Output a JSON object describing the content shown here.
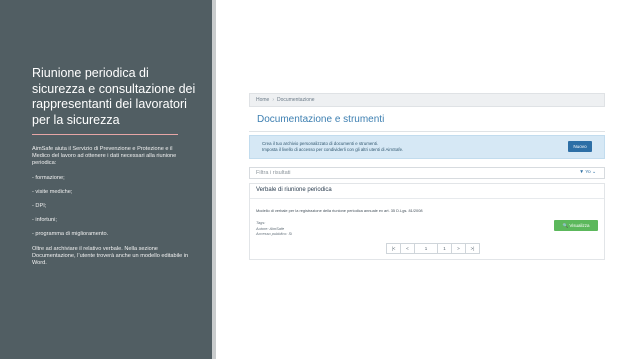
{
  "slide": {
    "title": "Riunione periodica di sicurezza e consultazione dei rappresentanti dei lavoratori per la sicurezza",
    "intro": "AimSafe aiuta il Servizio di Prevenzione e Protezione e il Medico del lavoro ad ottenere i dati necessari alla riunione periodica:",
    "items": [
      "- formazione;",
      "- visite mediche;",
      "- DPI;",
      "- infortuni;",
      "- programma di miglioramento."
    ],
    "outro": "Oltre ad archiviare il relativo verbale. Nella sezione Documentazione, l’utente troverà anche un modello editabile in Word."
  },
  "app": {
    "breadcrumb": {
      "home": "Home",
      "sep": "›",
      "current": "Documentazione"
    },
    "page_title": "Documentazione e strumenti",
    "info": {
      "line1": "Crea il tuo archivio personalizzato di documenti e strumenti.",
      "line2": "Imposta il livello di accesso per condividerli con gli altri utenti di AimSafe.",
      "button": "Nuovo"
    },
    "filter": {
      "placeholder": "Filtra i risultati",
      "control": "▼ Yo ⌄"
    },
    "document": {
      "title": "Verbale di riunione periodica",
      "description": "Modello di verbale per la registrazione della riunione periodica annuale ex art. 35 D.Lgs. 81/2008",
      "tags_label": "Tags:",
      "author_label": "Autore:",
      "author": "AimSafe",
      "public_label": "Accesso pubblico:",
      "public": "Sì",
      "view_button": "🔍 Visualizza"
    },
    "pager": {
      "first": "|<",
      "prev": "<",
      "page": "1",
      "total": "1",
      "next": ">",
      "last": ">|"
    }
  },
  "colors": {
    "sidebar": "#515e63",
    "accent_rule": "#e7a6a6",
    "title_blue": "#3d7fb1",
    "info_bg": "#d6e8f5",
    "primary": "#2d6fa6",
    "success": "#5cb85c"
  }
}
